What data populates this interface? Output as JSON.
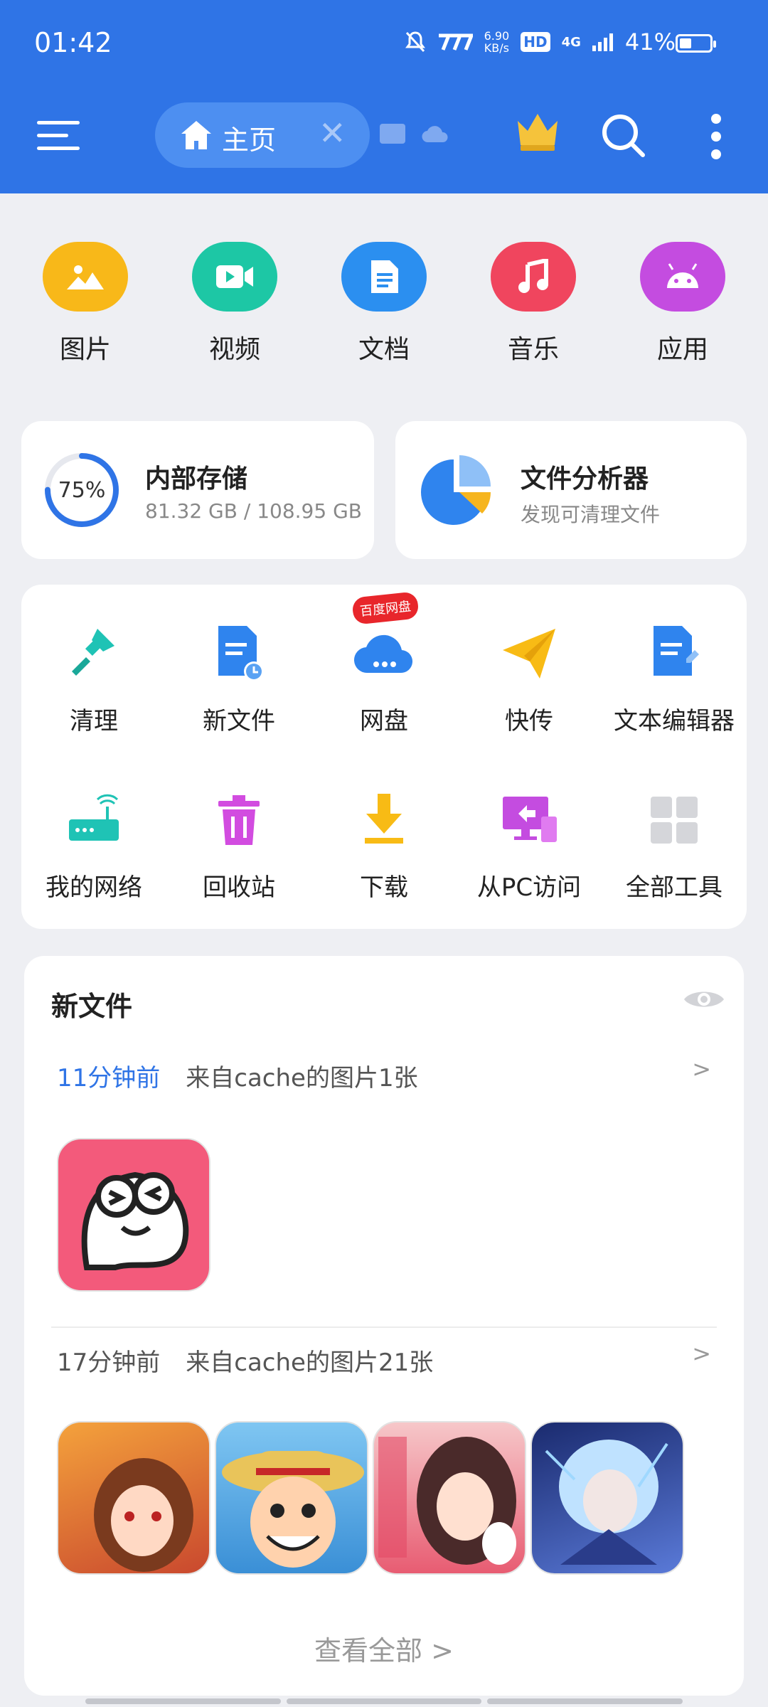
{
  "status_bar": {
    "time": "01:42",
    "net_speed_top": "6.90",
    "net_speed_bottom": "KB/s",
    "hd_label": "HD",
    "signal_label": "4G",
    "battery_text": "41%",
    "battery_level": 0.41
  },
  "header": {
    "home_tab_label": "主页",
    "accent_color": "#2f74e6"
  },
  "categories": [
    {
      "label": "图片",
      "icon": "picture-icon",
      "color": "#f8b819"
    },
    {
      "label": "视频",
      "icon": "video-icon",
      "color": "#1dc7a5"
    },
    {
      "label": "文档",
      "icon": "document-icon",
      "color": "#2b8ff0"
    },
    {
      "label": "音乐",
      "icon": "music-icon",
      "color": "#f0455e"
    },
    {
      "label": "应用",
      "icon": "android-icon",
      "color": "#c44ce0"
    }
  ],
  "storage": {
    "percent_label": "75%",
    "used_fraction": 0.75,
    "title": "内部存储",
    "detail": "81.32 GB / 108.95 GB"
  },
  "analyzer": {
    "title": "文件分析器",
    "subtitle": "发现可清理文件"
  },
  "tools": [
    {
      "label": "清理",
      "icon": "brush-icon"
    },
    {
      "label": "新文件",
      "icon": "new-file-icon"
    },
    {
      "label": "网盘",
      "icon": "cloud-drive-icon",
      "badge": "百度网盘"
    },
    {
      "label": "快传",
      "icon": "paper-plane-icon"
    },
    {
      "label": "文本编辑器",
      "icon": "text-editor-icon"
    },
    {
      "label": "我的网络",
      "icon": "router-icon"
    },
    {
      "label": "回收站",
      "icon": "trash-icon"
    },
    {
      "label": "下载",
      "icon": "download-icon"
    },
    {
      "label": "从PC访问",
      "icon": "pc-access-icon"
    },
    {
      "label": "全部工具",
      "icon": "all-tools-icon"
    }
  ],
  "new_files": {
    "title": "新文件",
    "groups": [
      {
        "when": "11分钟前",
        "desc": "来自cache的图片1张",
        "when_color": "#2f74e6"
      },
      {
        "when": "17分钟前",
        "desc": "来自cache的图片21张",
        "when_color": "#555555"
      }
    ],
    "chevron": ">",
    "view_all": "查看全部 >"
  }
}
